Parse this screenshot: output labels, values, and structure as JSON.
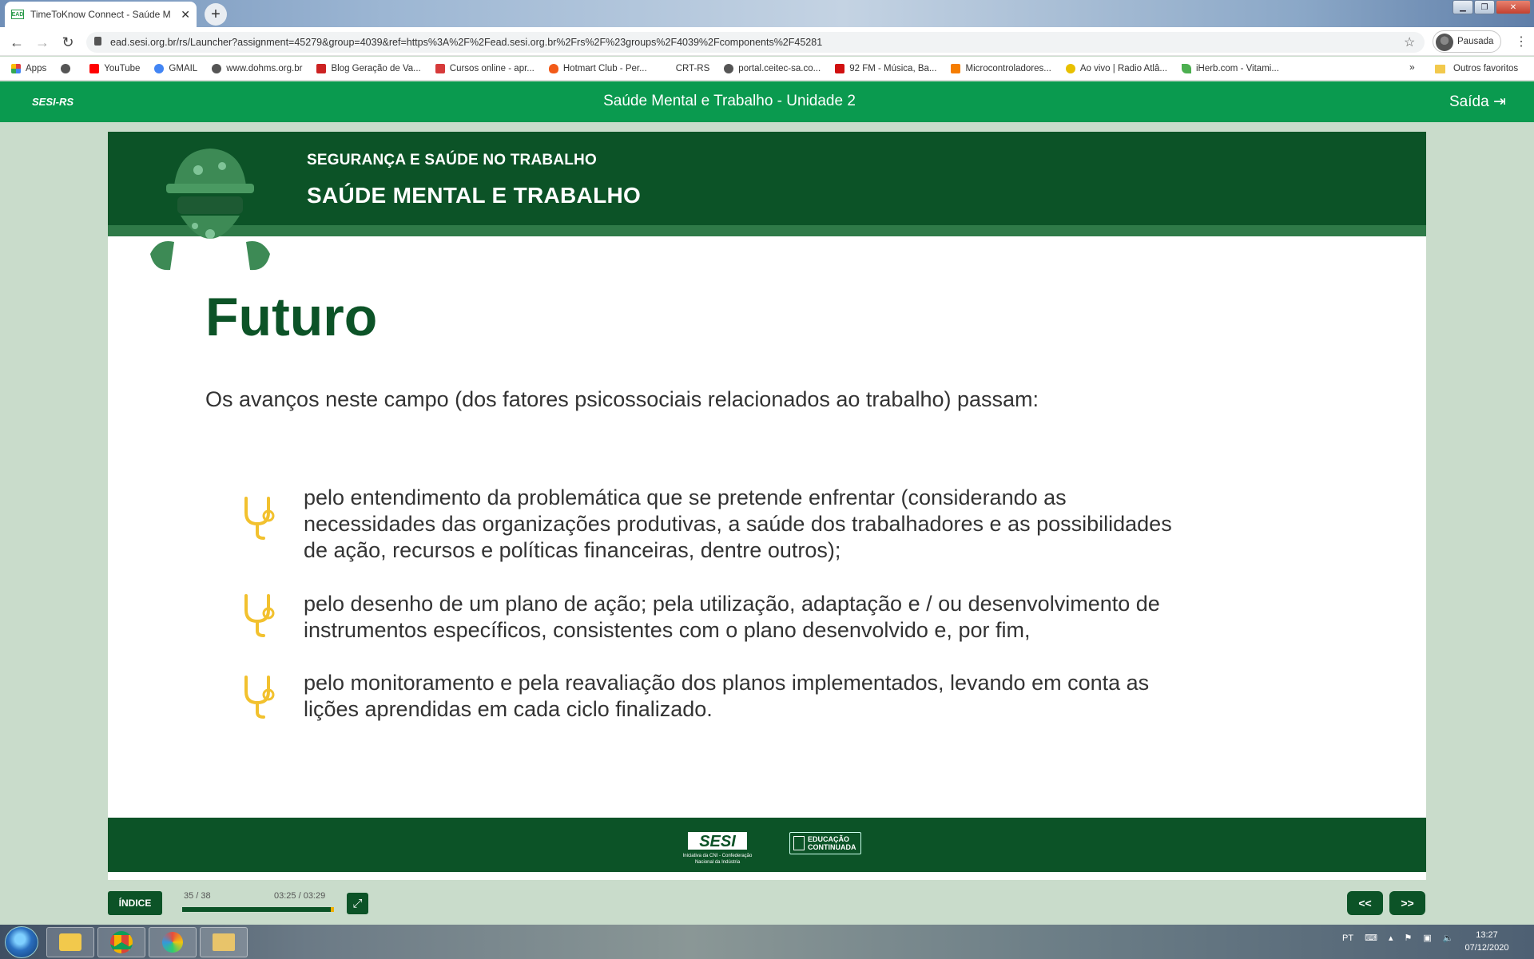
{
  "browser": {
    "tab_title": "TimeToKnow Connect - Saúde M",
    "tab_favicon": "EAD",
    "url": "ead.sesi.org.br/rs/Launcher?assignment=45279&group=4039&ref=https%3A%2F%2Fead.sesi.org.br%2Frs%2F%23groups%2F4039%2Fcomponents%2F45281",
    "profile_label": "Pausada",
    "bookmarks": [
      {
        "label": "Apps",
        "icon": "apps-grid-icon",
        "color": "#e04040"
      },
      {
        "label": "",
        "icon": "globe-icon",
        "color": "#555555"
      },
      {
        "label": "YouTube",
        "icon": "youtube-icon",
        "color": "#ff0000"
      },
      {
        "label": "GMAIL",
        "icon": "google-icon",
        "color": "#4285f4"
      },
      {
        "label": "www.dohms.org.br",
        "icon": "globe-icon",
        "color": "#555555"
      },
      {
        "label": "Blog Geração de Va...",
        "icon": "blog-icon",
        "color": "#cc2222"
      },
      {
        "label": "Cursos online - apr...",
        "icon": "course-icon",
        "color": "#d63a3a"
      },
      {
        "label": "Hotmart Club - Per...",
        "icon": "flame-icon",
        "color": "#f25a18"
      },
      {
        "label": "CRT-RS",
        "icon": "blank-icon",
        "color": "#ffffff"
      },
      {
        "label": "portal.ceitec-sa.co...",
        "icon": "globe-icon",
        "color": "#555555"
      },
      {
        "label": "92 FM - Música, Ba...",
        "icon": "radio-icon",
        "color": "#d01010"
      },
      {
        "label": "Microcontroladores...",
        "icon": "blogger-icon",
        "color": "#f57d00"
      },
      {
        "label": "Ao vivo | Radio Atlâ...",
        "icon": "radio-atlantida-icon",
        "color": "#e8c000"
      },
      {
        "label": "iHerb.com - Vitami...",
        "icon": "leaf-icon",
        "color": "#4caf50"
      }
    ],
    "bookmarks_more": "»",
    "other_bookmarks": "Outros favoritos"
  },
  "app": {
    "logo": "SESI-RS",
    "title": "Saúde Mental e Trabalho - Unidade 2",
    "exit_label": "Saída"
  },
  "lesson": {
    "category": "SEGURANÇA E SAÚDE NO TRABALHO",
    "course": "SAÚDE MENTAL E TRABALHO",
    "heading": "Futuro",
    "intro": "Os avanços neste campo (dos fatores psicossociais relacionados ao trabalho) passam:",
    "bullets": [
      {
        "line1": "pelo entendimento da problemática que se pretende enfrentar (considerando as",
        "line2": "necessidades das organizações produtivas, a saúde dos trabalhadores e as possibilidades",
        "line3": "de ação, recursos e políticas financeiras, dentre outros);"
      },
      {
        "line1": "pelo desenho de um plano de ação; pela utilização, adaptação e / ou desenvolvimento de",
        "line2": "instrumentos específicos, consistentes com o plano desenvolvido e, por fim,"
      },
      {
        "line1": "pelo monitoramento e pela reavaliação dos planos implementados, levando em conta as",
        "line2": "lições aprendidas em cada ciclo finalizado."
      }
    ],
    "bullet_icon": "stethoscope-icon",
    "bullet_color": "#f2c12e"
  },
  "footer": {
    "sesi_logo": "SESI",
    "sesi_tagline_1": "Iniciativa da CNI - Confederação",
    "sesi_tagline_2": "Nacional da Indústria",
    "educ_line1": "EDUCAÇÃO",
    "educ_line2": "CONTINUADA"
  },
  "player": {
    "index_label": "ÍNDICE",
    "page_count": "35 / 38",
    "time": "03:25 / 03:29",
    "progress": 0.98,
    "prev_label": "<<",
    "next_label": ">>"
  },
  "taskbar": {
    "language": "PT",
    "time": "13:27",
    "date": "07/12/2020"
  },
  "colors": {
    "brand_green": "#0a9a4f",
    "dark_green": "#0c5327",
    "accent_yellow": "#f2c12e"
  }
}
